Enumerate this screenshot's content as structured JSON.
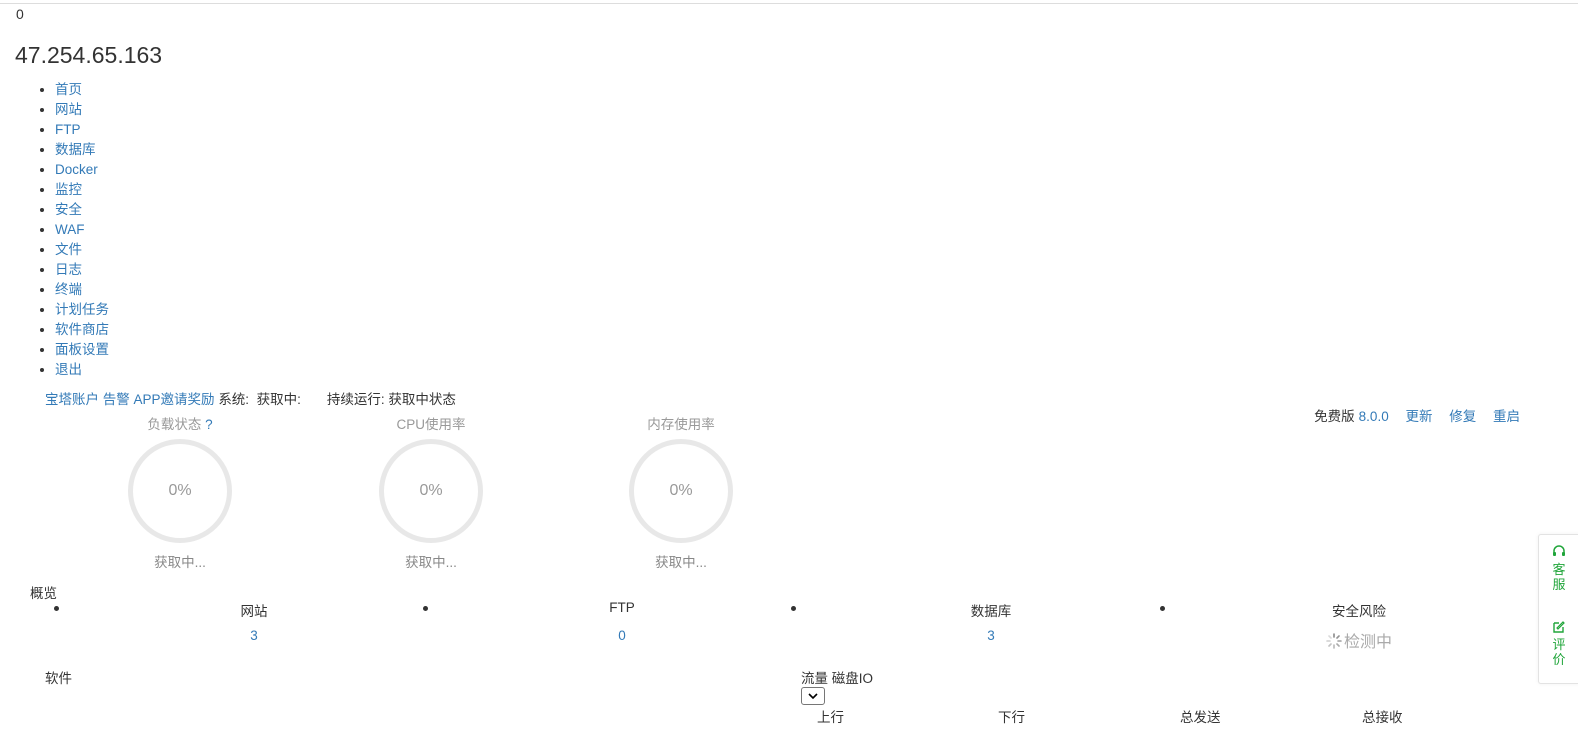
{
  "top": {
    "counter": "0",
    "server_ip": "47.254.65.163"
  },
  "nav": [
    "首页",
    "网站",
    "FTP",
    "数据库",
    "Docker",
    "监控",
    "安全",
    "WAF",
    "文件",
    "日志",
    "终端",
    "计划任务",
    "软件商店",
    "面板设置",
    "退出"
  ],
  "infobar": {
    "account": "宝塔账户",
    "alarm": "告警",
    "app": "APP",
    "invite": "邀请奖励",
    "system_label": "系统:",
    "system_value": "获取中:",
    "uptime_label": "持续运行:",
    "uptime_value": "获取中状态"
  },
  "version_bar": {
    "edition": "免费版",
    "version": "8.0.0",
    "update": "更新",
    "repair": "修复",
    "restart": "重启"
  },
  "gauges": [
    {
      "title": "负载状态",
      "help": "?",
      "value": "0%",
      "status": "获取中..."
    },
    {
      "title": "CPU使用率",
      "value": "0%",
      "status": "获取中..."
    },
    {
      "title": "内存使用率",
      "value": "0%",
      "status": "获取中..."
    }
  ],
  "overview": {
    "title": "概览",
    "items": [
      {
        "label": "网站",
        "value": "3"
      },
      {
        "label": "FTP",
        "value": "0"
      },
      {
        "label": "数据库",
        "value": "3"
      },
      {
        "label": "安全风险",
        "value": "检测中"
      }
    ]
  },
  "software": {
    "title": "软件"
  },
  "traffic": {
    "tab_traffic": "流量",
    "tab_disk": "磁盘IO",
    "columns": [
      "上行",
      "下行",
      "总发送",
      "总接收"
    ]
  },
  "side_panel": {
    "service": "客服",
    "review": "评价",
    "accent": "#20a53a"
  }
}
